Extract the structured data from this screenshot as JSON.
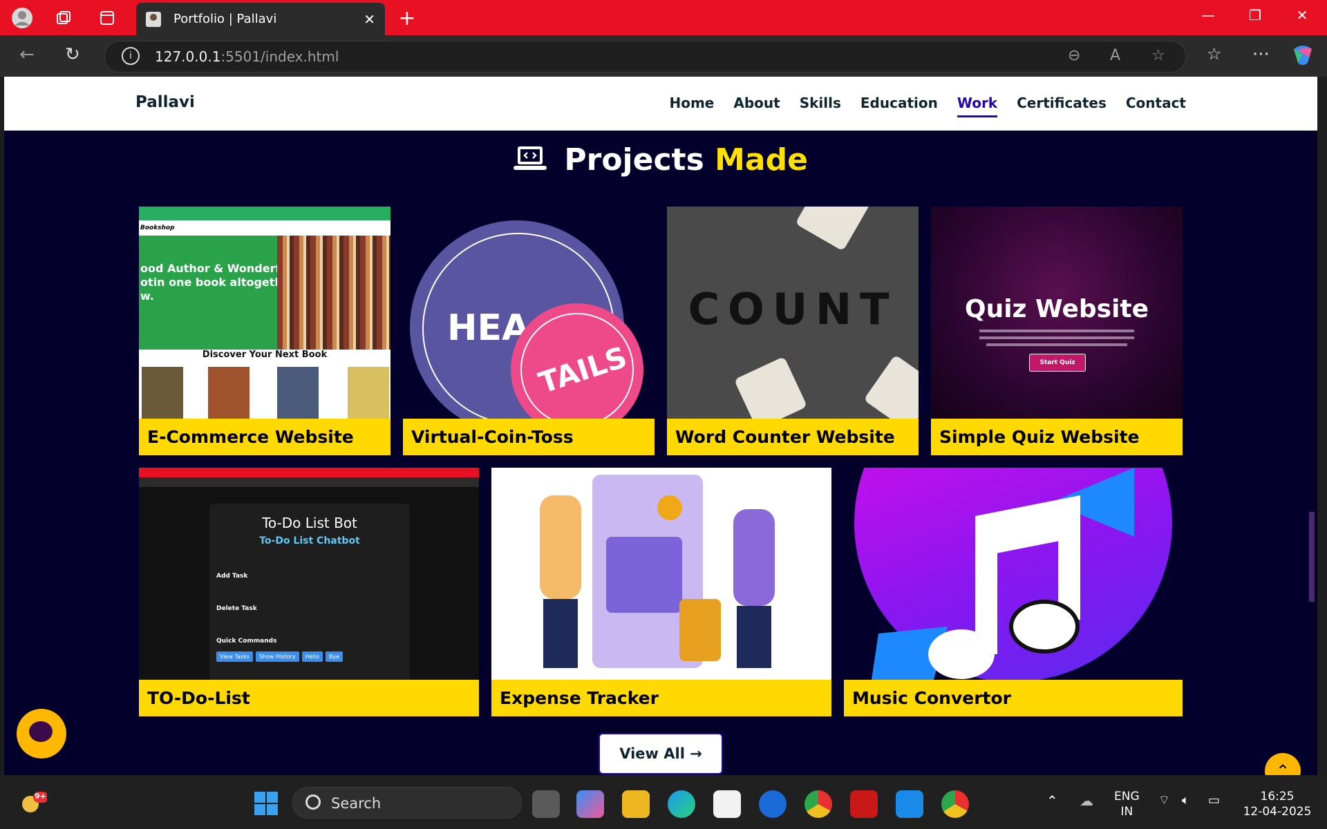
{
  "browser": {
    "tab_title": "Portfolio | Pallavi",
    "url_host": "127.0.0.1",
    "url_rest": ":5501/index.html"
  },
  "site": {
    "brand": "Pallavi",
    "nav": [
      "Home",
      "About",
      "Skills",
      "Education",
      "Work",
      "Certificates",
      "Contact"
    ],
    "active_nav": "Work",
    "section_title_main": "Projects",
    "section_title_accent": "Made",
    "projects": [
      "E-Commerce Website",
      "Virtual-Coin-Toss",
      "Word Counter Website",
      "Simple Quiz Website",
      "TO-Do-List",
      "Expense Tracker",
      "Music Convertor"
    ],
    "view_all": "View All →",
    "thumb_text": {
      "bookshop_brand": "Bookshop",
      "bookshop_hero": "ood Author & Wonderful\notin one book altogether\nw.",
      "bookshop_discover": "Discover Your Next Book",
      "coin_heads": "HEA",
      "coin_tails": "TAILS",
      "word_counter": "COUNT",
      "quiz_title": "Quiz Website",
      "quiz_button": "Start Quiz",
      "todo_title": "To-Do List Bot",
      "todo_subtitle": "To-Do List Chatbot",
      "todo_add": "Add Task",
      "todo_delete": "Delete Task",
      "todo_quick": "Quick Commands",
      "todo_cmds": [
        "View Tasks",
        "Show History",
        "Hello",
        "Bye"
      ]
    }
  },
  "taskbar": {
    "search": "Search",
    "lang_1": "ENG",
    "lang_2": "IN",
    "time": "16:25",
    "date": "12-04-2025",
    "badge": "9+"
  }
}
